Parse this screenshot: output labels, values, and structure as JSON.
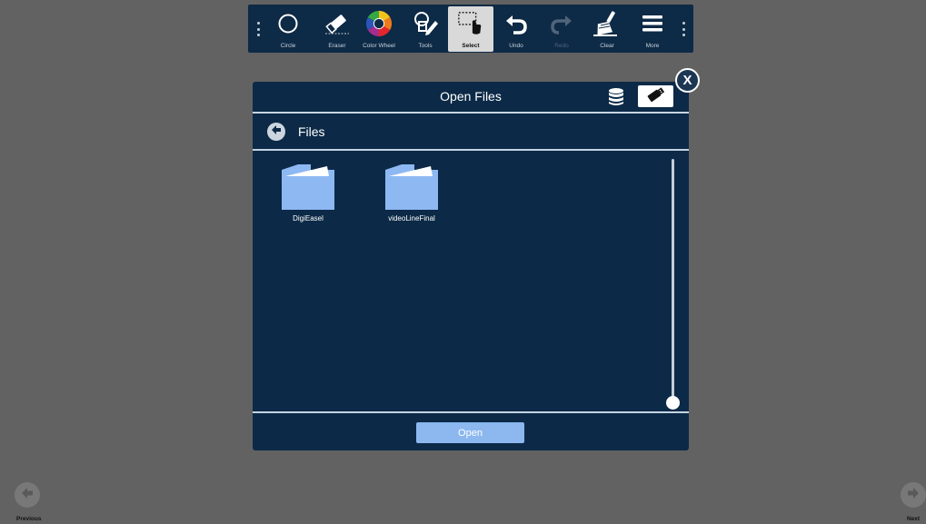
{
  "toolbar": {
    "items": [
      {
        "label": "Circle",
        "icon": "circle-icon"
      },
      {
        "label": "Eraser",
        "icon": "eraser-icon"
      },
      {
        "label": "Color Wheel",
        "icon": "color-wheel-icon"
      },
      {
        "label": "Tools",
        "icon": "tools-icon"
      },
      {
        "label": "Select",
        "icon": "select-icon",
        "state": "active"
      },
      {
        "label": "Undo",
        "icon": "undo-icon"
      },
      {
        "label": "Redo",
        "icon": "redo-icon",
        "state": "disabled"
      },
      {
        "label": "Clear",
        "icon": "clear-broom-icon"
      },
      {
        "label": "More",
        "icon": "hamburger-menu-icon"
      }
    ]
  },
  "dialog": {
    "title": "Open Files",
    "path_label": "Files",
    "close_label": "X",
    "files": [
      {
        "name": "DigiEasel",
        "type": "folder"
      },
      {
        "name": "videoLineFinal",
        "type": "folder"
      }
    ],
    "open_label": "Open"
  },
  "nav": {
    "previous_label": "Previous",
    "next_label": "Next"
  },
  "colors": {
    "background": "#626262",
    "panel": "#0c2a47",
    "toolbar": "#0d2a46",
    "accent_button": "#8cb7ef",
    "folder": "#8db8f2"
  }
}
